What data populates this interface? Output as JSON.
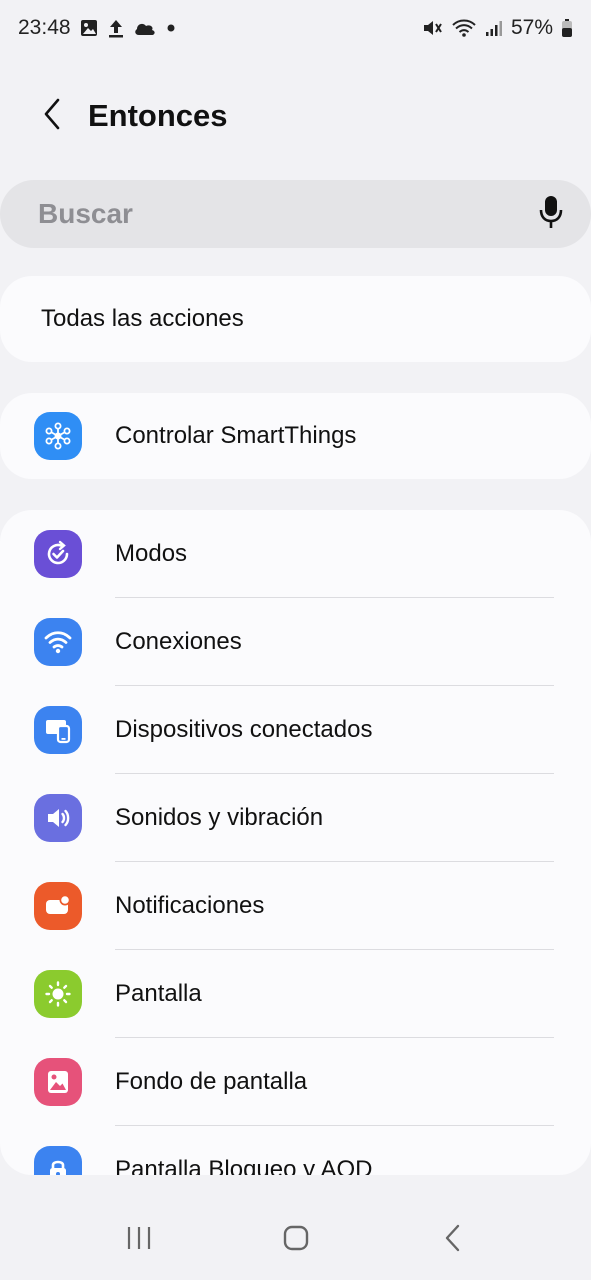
{
  "status_bar": {
    "time": "23:48",
    "battery": "57%",
    "icons": [
      "gallery-icon",
      "upload-icon",
      "cloud-icon",
      "dot-icon",
      "mute-icon",
      "wifi-icon",
      "signal-icon",
      "battery-icon"
    ]
  },
  "header": {
    "title": "Entonces",
    "back_icon": "chevron-left-icon"
  },
  "search": {
    "placeholder": "Buscar",
    "mic_icon": "mic-icon"
  },
  "all_actions": {
    "label": "Todas las acciones"
  },
  "smartthings": {
    "label": "Controlar SmartThings",
    "icon": "smartthings-icon",
    "color": "#2f8ef5"
  },
  "settings": {
    "items": [
      {
        "label": "Modos",
        "icon": "modes-icon",
        "color": "#6a4fd6"
      },
      {
        "label": "Conexiones",
        "icon": "wifi-icon",
        "color": "#3c83f0"
      },
      {
        "label": "Dispositivos conectados",
        "icon": "devices-icon",
        "color": "#3c83f0"
      },
      {
        "label": "Sonidos y vibración",
        "icon": "sound-icon",
        "color": "#6a6fe0"
      },
      {
        "label": "Notificaciones",
        "icon": "notifications-icon",
        "color": "#ec5a2a"
      },
      {
        "label": "Pantalla",
        "icon": "brightness-icon",
        "color": "#8bcb2e"
      },
      {
        "label": "Fondo de pantalla",
        "icon": "wallpaper-icon",
        "color": "#e6527a"
      },
      {
        "label": "Pantalla Bloqueo y AOD",
        "icon": "lock-icon",
        "color": "#3c83f0"
      }
    ]
  },
  "nav": {
    "recents_icon": "recents-icon",
    "home_icon": "home-icon",
    "back_icon": "back-icon"
  }
}
